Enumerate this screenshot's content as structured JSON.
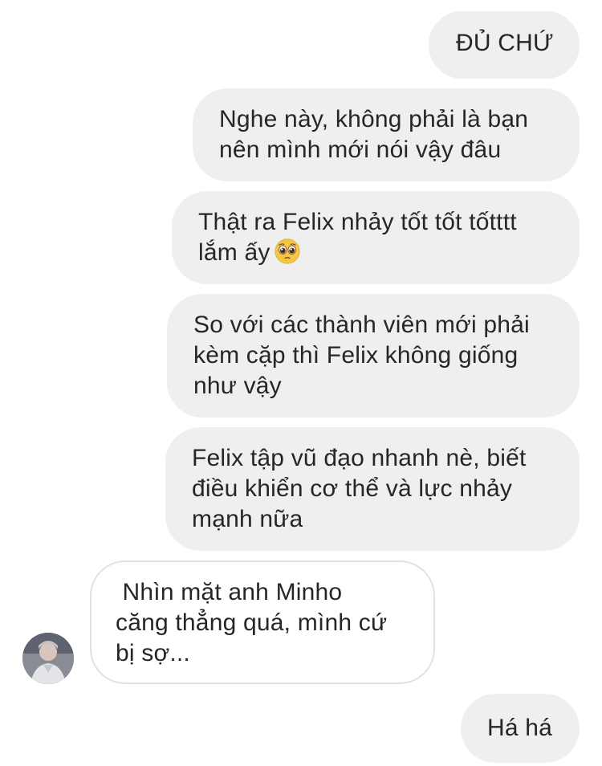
{
  "messages": [
    {
      "id": "m1",
      "direction": "sent",
      "lines": [
        "ĐỦ CHỨ"
      ]
    },
    {
      "id": "m2",
      "direction": "sent",
      "lines": [
        "Nghe này, không phải là bạn",
        "nên mình mới nói vậy đâu"
      ]
    },
    {
      "id": "m3",
      "direction": "sent",
      "lines": [
        "Thật ra Felix nhảy tốt tốt tốtttt",
        "lắm ấy"
      ],
      "emoji": "pleading-face-emoji"
    },
    {
      "id": "m4",
      "direction": "sent",
      "lines": [
        "So với các thành viên mới phải",
        "kèm cặp thì Felix không giống",
        "như vậy"
      ]
    },
    {
      "id": "m5",
      "direction": "sent",
      "lines": [
        "Felix tập vũ đạo nhanh nè, biết",
        "điều khiển cơ thể và lực nhảy",
        "mạnh nữa"
      ]
    },
    {
      "id": "m6",
      "direction": "received",
      "lines": [
        " Nhìn mặt anh Minho",
        "căng thẳng quá, mình cứ",
        "bị sợ..."
      ]
    },
    {
      "id": "m7",
      "direction": "sent",
      "lines": [
        "Há há"
      ]
    }
  ],
  "colors": {
    "sent_bubble": "#efefef",
    "received_border": "#e2e2e2",
    "text": "#262626"
  }
}
